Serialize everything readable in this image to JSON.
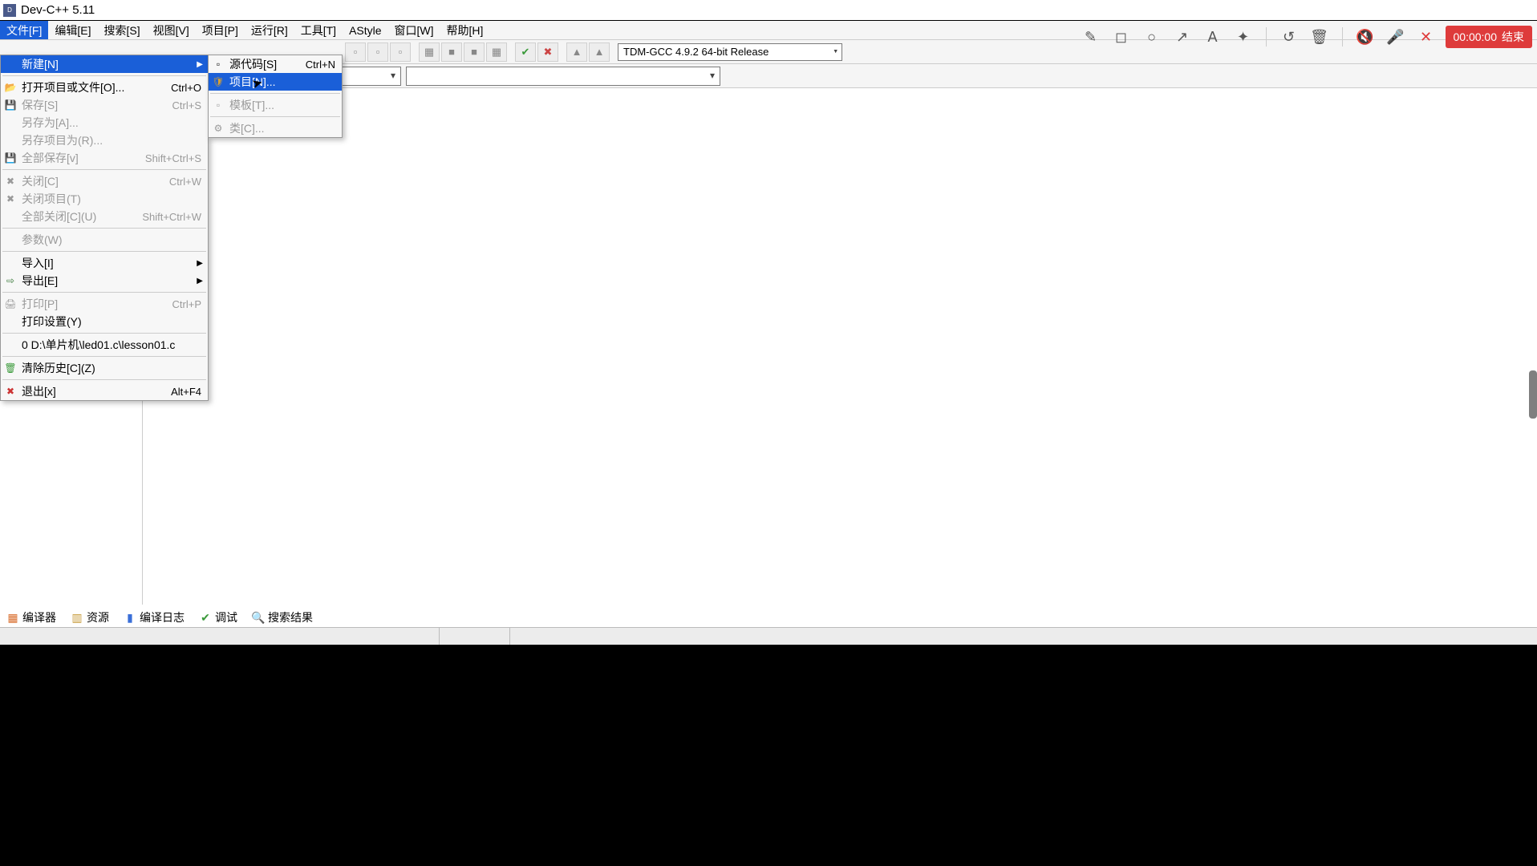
{
  "window": {
    "title": "Dev-C++ 5.11"
  },
  "menubar": {
    "items": [
      "文件[F]",
      "编辑[E]",
      "搜索[S]",
      "视图[V]",
      "项目[P]",
      "运行[R]",
      "工具[T]",
      "AStyle",
      "窗口[W]",
      "帮助[H]"
    ]
  },
  "file_menu": {
    "new": "新建[N]",
    "open": {
      "label": "打开项目或文件[O]...",
      "shortcut": "Ctrl+O"
    },
    "save": {
      "label": "保存[S]",
      "shortcut": "Ctrl+S"
    },
    "saveas": {
      "label": "另存为[A]..."
    },
    "save_project_as": {
      "label": "另存项目为(R)..."
    },
    "save_all": {
      "label": "全部保存[v]",
      "shortcut": "Shift+Ctrl+S"
    },
    "close": {
      "label": "关闭[C]",
      "shortcut": "Ctrl+W"
    },
    "close_project": {
      "label": "关闭项目(T)"
    },
    "close_all": {
      "label": "全部关闭[C](U)",
      "shortcut": "Shift+Ctrl+W"
    },
    "params": {
      "label": "参数(W)"
    },
    "import": {
      "label": "导入[I]"
    },
    "export": {
      "label": "导出[E]"
    },
    "print": {
      "label": "打印[P]",
      "shortcut": "Ctrl+P"
    },
    "print_setup": {
      "label": "打印设置(Y)"
    },
    "recent0": {
      "label": "0 D:\\单片机\\led01.c\\lesson01.c"
    },
    "clear_history": {
      "label": "清除历史[C](Z)"
    },
    "exit": {
      "label": "退出[x]",
      "shortcut": "Alt+F4"
    }
  },
  "submenu_new": {
    "source": {
      "label": "源代码[S]",
      "shortcut": "Ctrl+N"
    },
    "project": {
      "label": "项目[N]..."
    },
    "template": {
      "label": "模板[T]..."
    },
    "class": {
      "label": "类[C]..."
    }
  },
  "compiler_combo": "TDM-GCC 4.9.2 64-bit Release",
  "bottom_tabs": {
    "compiler": "编译器",
    "resources": "资源",
    "compile_log": "编译日志",
    "debug": "调试",
    "search_results": "搜索结果"
  },
  "recorder": {
    "time": "00:00:00",
    "end": "结束"
  }
}
